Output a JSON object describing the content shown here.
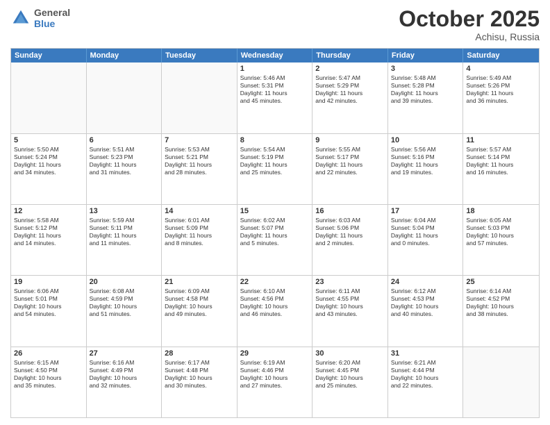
{
  "header": {
    "logo": {
      "general": "General",
      "blue": "Blue"
    },
    "title": "October 2025",
    "location": "Achisu, Russia"
  },
  "weekdays": [
    "Sunday",
    "Monday",
    "Tuesday",
    "Wednesday",
    "Thursday",
    "Friday",
    "Saturday"
  ],
  "rows": [
    [
      {
        "day": "",
        "text": ""
      },
      {
        "day": "",
        "text": ""
      },
      {
        "day": "",
        "text": ""
      },
      {
        "day": "1",
        "text": "Sunrise: 5:46 AM\nSunset: 5:31 PM\nDaylight: 11 hours\nand 45 minutes."
      },
      {
        "day": "2",
        "text": "Sunrise: 5:47 AM\nSunset: 5:29 PM\nDaylight: 11 hours\nand 42 minutes."
      },
      {
        "day": "3",
        "text": "Sunrise: 5:48 AM\nSunset: 5:28 PM\nDaylight: 11 hours\nand 39 minutes."
      },
      {
        "day": "4",
        "text": "Sunrise: 5:49 AM\nSunset: 5:26 PM\nDaylight: 11 hours\nand 36 minutes."
      }
    ],
    [
      {
        "day": "5",
        "text": "Sunrise: 5:50 AM\nSunset: 5:24 PM\nDaylight: 11 hours\nand 34 minutes."
      },
      {
        "day": "6",
        "text": "Sunrise: 5:51 AM\nSunset: 5:23 PM\nDaylight: 11 hours\nand 31 minutes."
      },
      {
        "day": "7",
        "text": "Sunrise: 5:53 AM\nSunset: 5:21 PM\nDaylight: 11 hours\nand 28 minutes."
      },
      {
        "day": "8",
        "text": "Sunrise: 5:54 AM\nSunset: 5:19 PM\nDaylight: 11 hours\nand 25 minutes."
      },
      {
        "day": "9",
        "text": "Sunrise: 5:55 AM\nSunset: 5:17 PM\nDaylight: 11 hours\nand 22 minutes."
      },
      {
        "day": "10",
        "text": "Sunrise: 5:56 AM\nSunset: 5:16 PM\nDaylight: 11 hours\nand 19 minutes."
      },
      {
        "day": "11",
        "text": "Sunrise: 5:57 AM\nSunset: 5:14 PM\nDaylight: 11 hours\nand 16 minutes."
      }
    ],
    [
      {
        "day": "12",
        "text": "Sunrise: 5:58 AM\nSunset: 5:12 PM\nDaylight: 11 hours\nand 14 minutes."
      },
      {
        "day": "13",
        "text": "Sunrise: 5:59 AM\nSunset: 5:11 PM\nDaylight: 11 hours\nand 11 minutes."
      },
      {
        "day": "14",
        "text": "Sunrise: 6:01 AM\nSunset: 5:09 PM\nDaylight: 11 hours\nand 8 minutes."
      },
      {
        "day": "15",
        "text": "Sunrise: 6:02 AM\nSunset: 5:07 PM\nDaylight: 11 hours\nand 5 minutes."
      },
      {
        "day": "16",
        "text": "Sunrise: 6:03 AM\nSunset: 5:06 PM\nDaylight: 11 hours\nand 2 minutes."
      },
      {
        "day": "17",
        "text": "Sunrise: 6:04 AM\nSunset: 5:04 PM\nDaylight: 11 hours\nand 0 minutes."
      },
      {
        "day": "18",
        "text": "Sunrise: 6:05 AM\nSunset: 5:03 PM\nDaylight: 10 hours\nand 57 minutes."
      }
    ],
    [
      {
        "day": "19",
        "text": "Sunrise: 6:06 AM\nSunset: 5:01 PM\nDaylight: 10 hours\nand 54 minutes."
      },
      {
        "day": "20",
        "text": "Sunrise: 6:08 AM\nSunset: 4:59 PM\nDaylight: 10 hours\nand 51 minutes."
      },
      {
        "day": "21",
        "text": "Sunrise: 6:09 AM\nSunset: 4:58 PM\nDaylight: 10 hours\nand 49 minutes."
      },
      {
        "day": "22",
        "text": "Sunrise: 6:10 AM\nSunset: 4:56 PM\nDaylight: 10 hours\nand 46 minutes."
      },
      {
        "day": "23",
        "text": "Sunrise: 6:11 AM\nSunset: 4:55 PM\nDaylight: 10 hours\nand 43 minutes."
      },
      {
        "day": "24",
        "text": "Sunrise: 6:12 AM\nSunset: 4:53 PM\nDaylight: 10 hours\nand 40 minutes."
      },
      {
        "day": "25",
        "text": "Sunrise: 6:14 AM\nSunset: 4:52 PM\nDaylight: 10 hours\nand 38 minutes."
      }
    ],
    [
      {
        "day": "26",
        "text": "Sunrise: 6:15 AM\nSunset: 4:50 PM\nDaylight: 10 hours\nand 35 minutes."
      },
      {
        "day": "27",
        "text": "Sunrise: 6:16 AM\nSunset: 4:49 PM\nDaylight: 10 hours\nand 32 minutes."
      },
      {
        "day": "28",
        "text": "Sunrise: 6:17 AM\nSunset: 4:48 PM\nDaylight: 10 hours\nand 30 minutes."
      },
      {
        "day": "29",
        "text": "Sunrise: 6:19 AM\nSunset: 4:46 PM\nDaylight: 10 hours\nand 27 minutes."
      },
      {
        "day": "30",
        "text": "Sunrise: 6:20 AM\nSunset: 4:45 PM\nDaylight: 10 hours\nand 25 minutes."
      },
      {
        "day": "31",
        "text": "Sunrise: 6:21 AM\nSunset: 4:44 PM\nDaylight: 10 hours\nand 22 minutes."
      },
      {
        "day": "",
        "text": ""
      }
    ]
  ]
}
